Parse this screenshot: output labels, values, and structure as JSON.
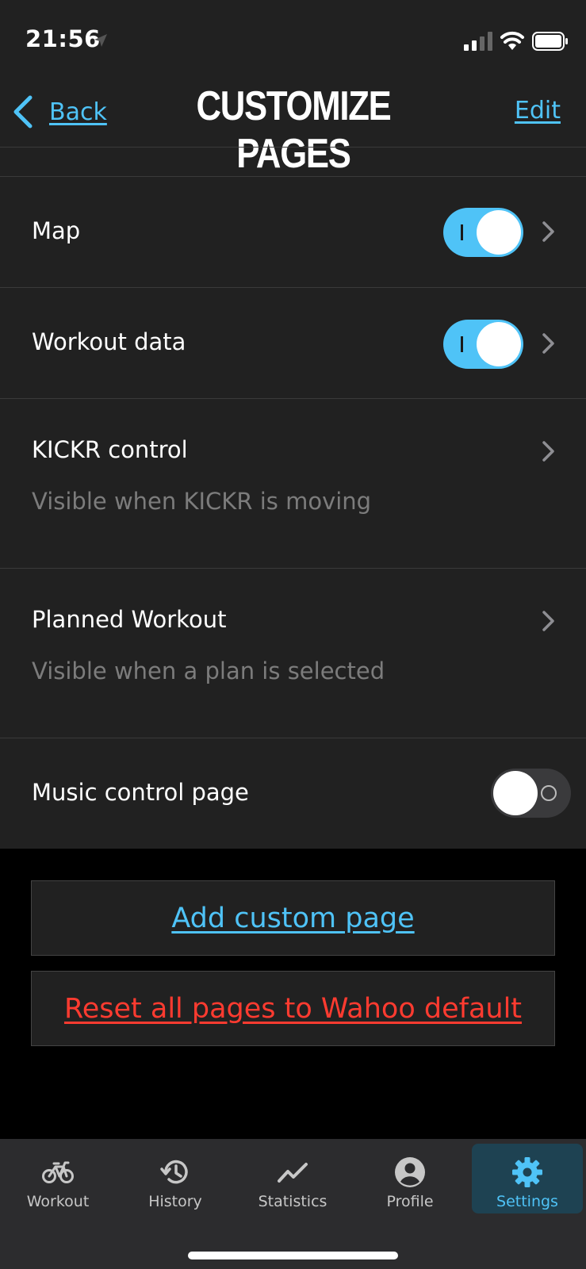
{
  "status": {
    "time": "21:56"
  },
  "nav": {
    "back_label": "Back",
    "title": "CUSTOMIZE PAGES",
    "edit_label": "Edit"
  },
  "pages": [
    {
      "label": "Map",
      "toggle": true,
      "chevron": true
    },
    {
      "label": "Workout data",
      "toggle": true,
      "chevron": true
    },
    {
      "label": "KICKR control",
      "subtitle": "Visible when KICKR is moving",
      "chevron": true
    },
    {
      "label": "Planned Workout",
      "subtitle": "Visible when a plan is selected",
      "chevron": true
    },
    {
      "label": "Music control page",
      "toggle": false
    }
  ],
  "actions": {
    "add_label": "Add custom page",
    "reset_label": "Reset all pages to Wahoo default"
  },
  "tabs": [
    {
      "label": "Workout",
      "icon": "bike-icon"
    },
    {
      "label": "History",
      "icon": "history-icon"
    },
    {
      "label": "Statistics",
      "icon": "statistics-icon"
    },
    {
      "label": "Profile",
      "icon": "profile-icon"
    },
    {
      "label": "Settings",
      "icon": "gear-icon",
      "active": true
    }
  ],
  "colors": {
    "accent": "#4fc3f7",
    "danger": "#ff3b30",
    "surface": "#212121",
    "background": "#000000"
  }
}
